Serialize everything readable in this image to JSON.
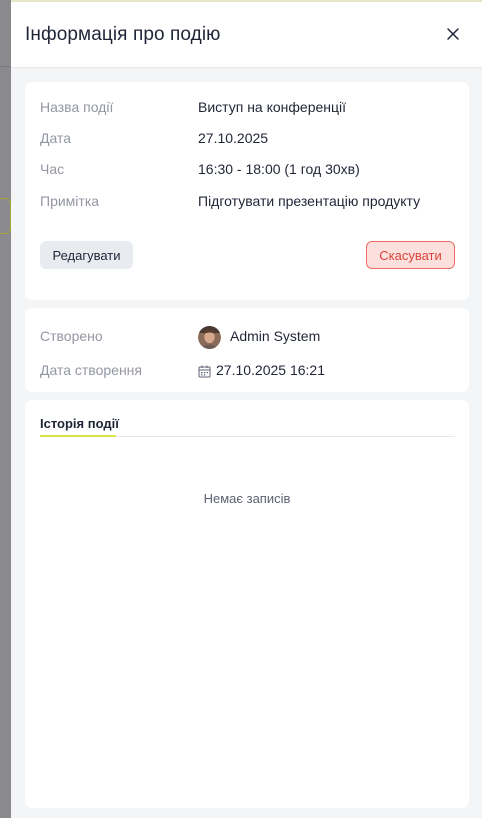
{
  "header": {
    "title": "Інформація про подію"
  },
  "event": {
    "rows": [
      {
        "label": "Назва події",
        "value": "Виступ на конференції"
      },
      {
        "label": "Дата",
        "value": "27.10.2025"
      },
      {
        "label": "Час",
        "value": "16:30 - 18:00 (1 год 30хв)"
      },
      {
        "label": "Примітка",
        "value": "Підготувати презентацію продукту"
      }
    ],
    "edit_label": "Редагувати",
    "cancel_label": "Скасувати"
  },
  "meta": {
    "created_by_label": "Створено",
    "created_by_name": "Admin System",
    "created_at_label": "Дата створення",
    "created_at_value": "27.10.2025 16:21"
  },
  "history": {
    "title": "Історія події",
    "empty_text": "Немає записів"
  },
  "colors": {
    "accent": "#d8e34a",
    "danger": "#d9433a",
    "text": "#1f2536",
    "muted": "#9497a3"
  },
  "icons": [
    "close-icon",
    "calendar-icon",
    "avatar"
  ]
}
